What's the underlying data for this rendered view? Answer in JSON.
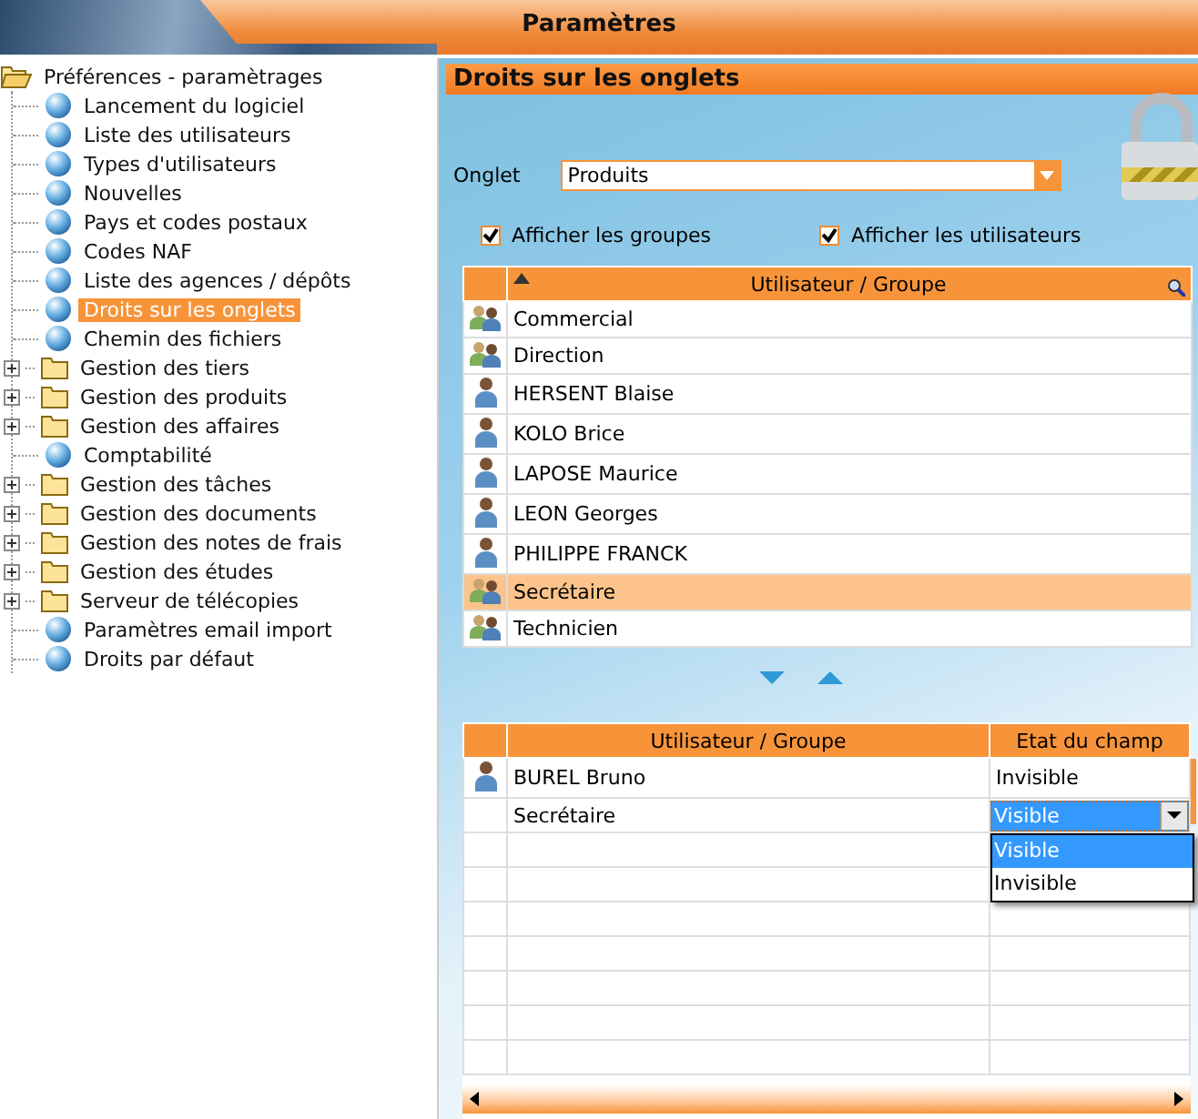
{
  "window": {
    "title": "Paramètres"
  },
  "tree": {
    "label": "Préférences - paramètrages",
    "kind": "folder",
    "expanded": true,
    "children": [
      {
        "label": "Lancement du logiciel",
        "kind": "leaf",
        "selected": false
      },
      {
        "label": "Liste des utilisateurs",
        "kind": "leaf",
        "selected": false
      },
      {
        "label": "Types d'utilisateurs",
        "kind": "leaf",
        "selected": false
      },
      {
        "label": "Nouvelles",
        "kind": "leaf",
        "selected": false
      },
      {
        "label": "Pays et codes postaux",
        "kind": "leaf",
        "selected": false
      },
      {
        "label": "Codes NAF",
        "kind": "leaf",
        "selected": false
      },
      {
        "label": "Liste des agences / dépôts",
        "kind": "leaf",
        "selected": false
      },
      {
        "label": "Droits sur les onglets",
        "kind": "leaf",
        "selected": true
      },
      {
        "label": "Chemin des fichiers",
        "kind": "leaf",
        "selected": false
      },
      {
        "label": "Gestion des tiers",
        "kind": "folder",
        "expanded": false,
        "selected": false
      },
      {
        "label": "Gestion des produits",
        "kind": "folder",
        "expanded": false,
        "selected": false
      },
      {
        "label": "Gestion des affaires",
        "kind": "folder",
        "expanded": false,
        "selected": false
      },
      {
        "label": "Comptabilité",
        "kind": "leaf",
        "selected": false
      },
      {
        "label": "Gestion des tâches",
        "kind": "folder",
        "expanded": false,
        "selected": false
      },
      {
        "label": "Gestion des documents",
        "kind": "folder",
        "expanded": false,
        "selected": false
      },
      {
        "label": "Gestion des notes de frais",
        "kind": "folder",
        "expanded": false,
        "selected": false
      },
      {
        "label": "Gestion des études",
        "kind": "folder",
        "expanded": false,
        "selected": false
      },
      {
        "label": "Serveur de télécopies",
        "kind": "folder",
        "expanded": false,
        "selected": false
      },
      {
        "label": "Paramètres email import",
        "kind": "leaf",
        "selected": false
      },
      {
        "label": "Droits par défaut",
        "kind": "leaf",
        "selected": false
      }
    ]
  },
  "panel": {
    "title": "Droits sur les onglets",
    "onglet": {
      "label": "Onglet",
      "value": "Produits"
    },
    "checkboxes": [
      {
        "label": "Afficher les groupes",
        "checked": true
      },
      {
        "label": "Afficher les utilisateurs",
        "checked": true
      }
    ],
    "table": {
      "column": "Utilisateur / Groupe",
      "rows": [
        {
          "name": "Commercial",
          "kind": "group",
          "selected": false
        },
        {
          "name": "Direction",
          "kind": "group",
          "selected": false
        },
        {
          "name": "HERSENT Blaise",
          "kind": "user",
          "selected": false
        },
        {
          "name": "KOLO Brice",
          "kind": "user",
          "selected": false
        },
        {
          "name": "LAPOSE Maurice",
          "kind": "user",
          "selected": false
        },
        {
          "name": "LEON Georges",
          "kind": "user",
          "selected": false
        },
        {
          "name": "PHILIPPE FRANCK",
          "kind": "user",
          "selected": false
        },
        {
          "name": "Secrétaire",
          "kind": "group",
          "selected": true
        },
        {
          "name": "Technicien",
          "kind": "group",
          "selected": false
        }
      ]
    },
    "rights": {
      "columns": [
        "Utilisateur / Groupe",
        "Etat du champ"
      ],
      "rows": [
        {
          "name": "BUREL Bruno",
          "kind": "user",
          "state": "Invisible",
          "editing": false
        },
        {
          "name": "Secrétaire",
          "kind": "plain",
          "state": "Visible",
          "editing": true,
          "options": [
            {
              "label": "Visible",
              "selected": true
            },
            {
              "label": "Invisible",
              "selected": false
            }
          ]
        }
      ]
    }
  }
}
